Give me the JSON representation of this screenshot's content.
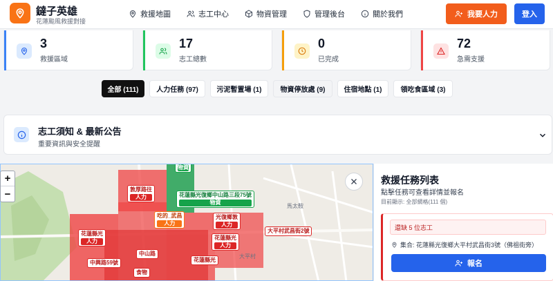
{
  "header": {
    "title": "鐽子英雄",
    "subtitle": "花蓮颱風救援對接",
    "nav": [
      {
        "label": "救援地圖",
        "icon": "map-pin-icon"
      },
      {
        "label": "志工中心",
        "icon": "users-icon"
      },
      {
        "label": "物資管理",
        "icon": "box-icon"
      },
      {
        "label": "管理後台",
        "icon": "shield-icon"
      },
      {
        "label": "關於我們",
        "icon": "info-icon"
      }
    ],
    "help_button": "我要人力",
    "login_button": "登入"
  },
  "stats": [
    {
      "value": "3",
      "label": "救援區域",
      "color": "#3b82f6",
      "icon": "map-pin-icon"
    },
    {
      "value": "17",
      "label": "志工總數",
      "color": "#22c55e",
      "icon": "users-icon"
    },
    {
      "value": "0",
      "label": "已完成",
      "color": "#f59e0b",
      "icon": "clock-icon"
    },
    {
      "value": "72",
      "label": "急需支援",
      "color": "#ef4444",
      "icon": "alert-icon"
    }
  ],
  "filters": [
    {
      "label": "全部 (111)",
      "active": true
    },
    {
      "label": "人力任務 (97)"
    },
    {
      "label": "污泥暫置場 (1)"
    },
    {
      "label": "物資停放處 (9)"
    },
    {
      "label": "住宿地點 (1)"
    },
    {
      "label": "領吃食區域 (3)"
    }
  ],
  "notice": {
    "title": "志工須知 & 最新公告",
    "subtitle": "重要資訊與安全提醒"
  },
  "map": {
    "zoom_in": "+",
    "zoom_out": "−",
    "streets": [
      "馬太鞍",
      "大平村"
    ],
    "markers": [
      {
        "text": "",
        "tag": "物資"
      },
      {
        "text": "敦厚路往",
        "tag": "人力"
      },
      {
        "text": "花蓮縣光復鄉中山路三段75號",
        "tag": "物資"
      },
      {
        "text": "吃的_武昌",
        "tag": "人力"
      },
      {
        "text": "光復鄉敦",
        "tag": "人力"
      },
      {
        "text": "花蓮縣光",
        "tag": "人力"
      },
      {
        "text": "花蓮縣光",
        "tag": "人力"
      },
      {
        "text": "中興路59號",
        "tag": ""
      },
      {
        "text": "中山路",
        "tag": ""
      },
      {
        "text": "花蓮縣光",
        "tag": ""
      },
      {
        "text": "食物",
        "tag": ""
      },
      {
        "text": "大平村武昌街2號",
        "tag": ""
      }
    ]
  },
  "panel": {
    "title": "救援任務列表",
    "subtitle": "點擊任務可查看詳情並報名",
    "showing": "目前顯示: 全部網格(111 個)",
    "task": {
      "need": "還缺 5 位志工",
      "location": "集合: 花蓮縣光復鄉大平村武昌街3號（佛祖街旁）",
      "signup": "報名"
    }
  }
}
